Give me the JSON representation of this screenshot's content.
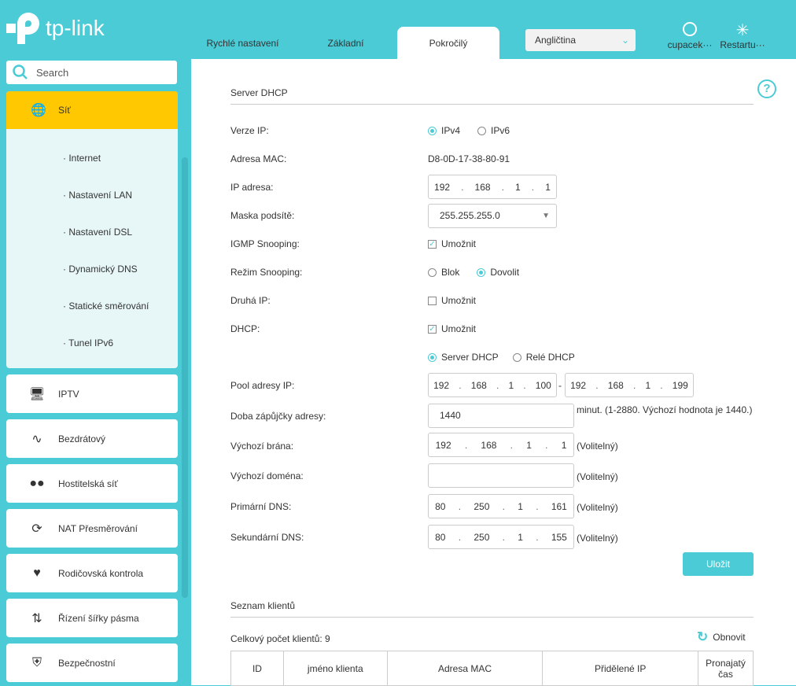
{
  "header": {
    "brand": "tp-link",
    "tabs": [
      {
        "label": "Rychlé nastavení"
      },
      {
        "label": "Základní"
      },
      {
        "label": "Pokročilý"
      }
    ],
    "active_tab": "Pokročilý",
    "language": "Angličtina",
    "user_label": "cupacek···",
    "restart_label": "Restartu···"
  },
  "sidebar": {
    "search_placeholder": "Search",
    "active_section": "Síť",
    "sub_items": [
      "Internet",
      "Nastavení LAN",
      "Nastavení DSL",
      "Dynamický DNS",
      "Statické směrování",
      "Tunel IPv6"
    ],
    "items": [
      {
        "label": "IPTV",
        "icon": "monitor-icon"
      },
      {
        "label": "Bezdrátový",
        "icon": "wifi-icon"
      },
      {
        "label": "Hostitelská síť",
        "icon": "guest-network-icon"
      },
      {
        "label": "NAT Přesměrování",
        "icon": "nat-icon"
      },
      {
        "label": "Rodičovská kontrola",
        "icon": "parental-control-icon"
      },
      {
        "label": "Řízení šířky pásma",
        "icon": "bandwidth-icon"
      },
      {
        "label": "Bezpečnostní",
        "icon": "shield-icon"
      }
    ]
  },
  "dhcp": {
    "title": "Server DHCP",
    "ip_version": {
      "label": "Verze IP:",
      "options": [
        "IPv4",
        "IPv6"
      ],
      "selected": "IPv4"
    },
    "mac": {
      "label": "Adresa MAC:",
      "value": "D8-0D-17-38-80-91"
    },
    "ip": {
      "label": "IP adresa:",
      "octets": [
        "192",
        "168",
        "1",
        "1"
      ]
    },
    "mask": {
      "label": "Maska podsítě:",
      "value": "255.255.255.0"
    },
    "igmp": {
      "label": "IGMP Snooping:",
      "option": "Umožnit",
      "checked": true
    },
    "snoop_mode": {
      "label": "Režim Snooping:",
      "options": [
        "Blok",
        "Dovolit"
      ],
      "selected": "Dovolit"
    },
    "second_ip": {
      "label": "Druhá IP:",
      "option": "Umožnit",
      "checked": false
    },
    "dhcp": {
      "label": "DHCP:",
      "option": "Umožnit",
      "checked": true
    },
    "dhcp_mode": {
      "options": [
        "Server DHCP",
        "Relé DHCP"
      ],
      "selected": "Server DHCP"
    },
    "pool": {
      "label": "Pool adresy IP:",
      "start": [
        "192",
        "168",
        "1",
        "100"
      ],
      "end": [
        "192",
        "168",
        "1",
        "199"
      ],
      "sep": "-"
    },
    "lease": {
      "label": "Doba zápůjčky adresy:",
      "value": "1440",
      "hint": "minut. (1-2880. Výchozí hodnota je 1440.)"
    },
    "gateway": {
      "label": "Výchozí brána:",
      "octets": [
        "192",
        "168",
        "1",
        "1"
      ],
      "hint": "(Volitelný)"
    },
    "domain": {
      "label": "Výchozí doména:",
      "value": "",
      "hint": "(Volitelný)"
    },
    "dns1": {
      "label": "Primární DNS:",
      "octets": [
        "80",
        "250",
        "1",
        "161"
      ],
      "hint": "(Volitelný)"
    },
    "dns2": {
      "label": "Sekundární DNS:",
      "octets": [
        "80",
        "250",
        "1",
        "155"
      ],
      "hint": "(Volitelný)"
    },
    "save": "Uložit"
  },
  "clients": {
    "title": "Seznam klientů",
    "total": "Celkový počet klientů: 9",
    "refresh": "Obnovit",
    "columns": [
      "ID",
      "jméno klienta",
      "Adresa MAC",
      "Přidělené IP",
      "Pronajatý čas"
    ]
  },
  "colors": {
    "accent": "#4acbd6",
    "active": "#ffc800"
  }
}
